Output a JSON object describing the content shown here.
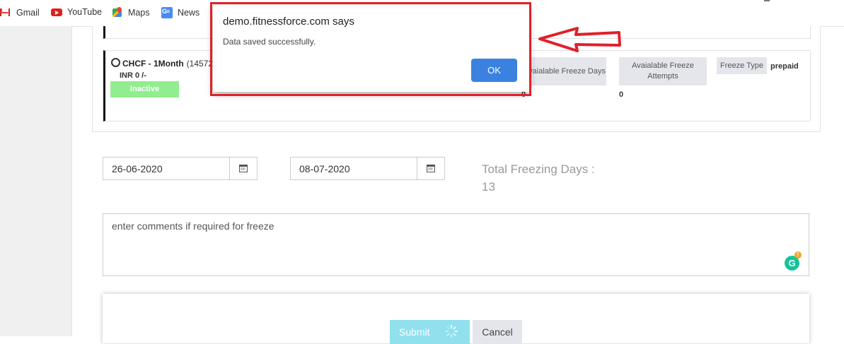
{
  "bookmarks": [
    {
      "label": "Gmail",
      "icon": "gmail-icon"
    },
    {
      "label": "YouTube",
      "icon": "youtube-icon"
    },
    {
      "label": "Maps",
      "icon": "maps-icon"
    },
    {
      "label": "News",
      "icon": "news-icon"
    }
  ],
  "membership": {
    "name": "CHCF - 1Month",
    "code": "(14572",
    "price": "INR 0 /-",
    "status": "Inactive",
    "available_freeze_days_label": "Avaialable Freeze Days",
    "available_freeze_days_value": "0",
    "available_freeze_attempts_label": "Avaialable Freeze Attempts",
    "available_freeze_attempts_value": "0",
    "freeze_type_label": "Freeze Type",
    "freeze_type_value": "prepaid"
  },
  "freeze": {
    "start_date": "26-06-2020",
    "end_date": "08-07-2020",
    "total_label": "Total Freezing Days :",
    "total_value": "13",
    "comments_placeholder": "enter comments if required for freeze"
  },
  "actions": {
    "submit_label": "Submit",
    "cancel_label": "Cancel"
  },
  "dialog": {
    "title": "demo.fitnessforce.com says",
    "message": "Data saved successfully.",
    "ok_label": "OK"
  },
  "colors": {
    "status_inactive": "#90ee90",
    "ok_button": "#3b82e0",
    "annotation": "#e0202a",
    "submit_button": "#90e0ee"
  }
}
